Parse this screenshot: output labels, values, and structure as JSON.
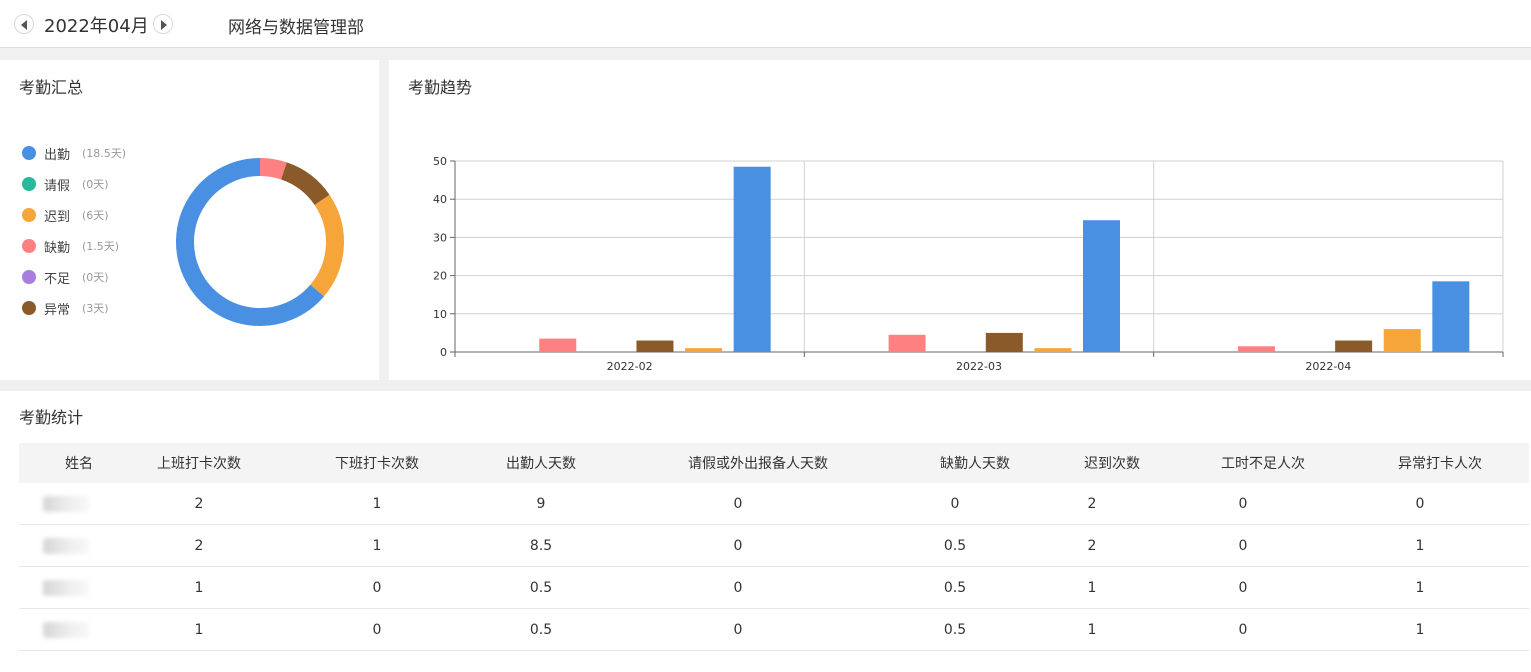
{
  "header": {
    "month": "2022年04月",
    "department": "网络与数据管理部"
  },
  "summary": {
    "title": "考勤汇总",
    "legend": [
      {
        "name": "出勤",
        "value": "(18.5天)",
        "color": "#4a90e2"
      },
      {
        "name": "请假",
        "value": "(0天)",
        "color": "#26b99a"
      },
      {
        "name": "迟到",
        "value": "(6天)",
        "color": "#f5a53a"
      },
      {
        "name": "缺勤",
        "value": "(1.5天)",
        "color": "#ff8080"
      },
      {
        "name": "不足",
        "value": "(0天)",
        "color": "#a77ee0"
      },
      {
        "name": "异常",
        "value": "(3天)",
        "color": "#8b5a2b"
      }
    ]
  },
  "trend": {
    "title": "考勤趋势"
  },
  "chart_data": [
    {
      "type": "pie",
      "labels": [
        "出勤",
        "请假",
        "迟到",
        "缺勤",
        "不足",
        "异常"
      ],
      "values": [
        18.5,
        0,
        6,
        1.5,
        0,
        3
      ],
      "colors": [
        "#4a90e2",
        "#26b99a",
        "#f5a53a",
        "#ff8080",
        "#a77ee0",
        "#8b5a2b"
      ]
    },
    {
      "type": "bar",
      "categories": [
        "2022-02",
        "2022-03",
        "2022-04"
      ],
      "series": [
        {
          "color": "#26b99a",
          "values": [
            0,
            0,
            0
          ]
        },
        {
          "color": "#ff8080",
          "values": [
            3.5,
            4.5,
            1.5
          ]
        },
        {
          "color": "#a77ee0",
          "values": [
            0,
            0,
            0
          ]
        },
        {
          "color": "#8b5a2b",
          "values": [
            3,
            5,
            3
          ]
        },
        {
          "color": "#f5a53a",
          "values": [
            1,
            1,
            6
          ]
        },
        {
          "color": "#4a90e2",
          "values": [
            48.5,
            34.5,
            18.5
          ]
        }
      ],
      "ylim": [
        0,
        50
      ],
      "yticks": [
        0,
        10,
        20,
        30,
        40,
        50
      ],
      "grid": true
    }
  ],
  "stats": {
    "title": "考勤统计",
    "columns": [
      "姓名",
      "上班打卡次数",
      "下班打卡次数",
      "出勤人天数",
      "请假或外出报备人天数",
      "缺勤人天数",
      "迟到次数",
      "工时不足人次",
      "异常打卡人次"
    ],
    "rows": [
      [
        "2",
        "1",
        "9",
        "0",
        "0",
        "2",
        "0",
        "0"
      ],
      [
        "2",
        "1",
        "8.5",
        "0",
        "0.5",
        "2",
        "0",
        "1"
      ],
      [
        "1",
        "0",
        "0.5",
        "0",
        "0.5",
        "1",
        "0",
        "1"
      ],
      [
        "1",
        "0",
        "0.5",
        "0",
        "0.5",
        "1",
        "0",
        "1"
      ]
    ]
  }
}
